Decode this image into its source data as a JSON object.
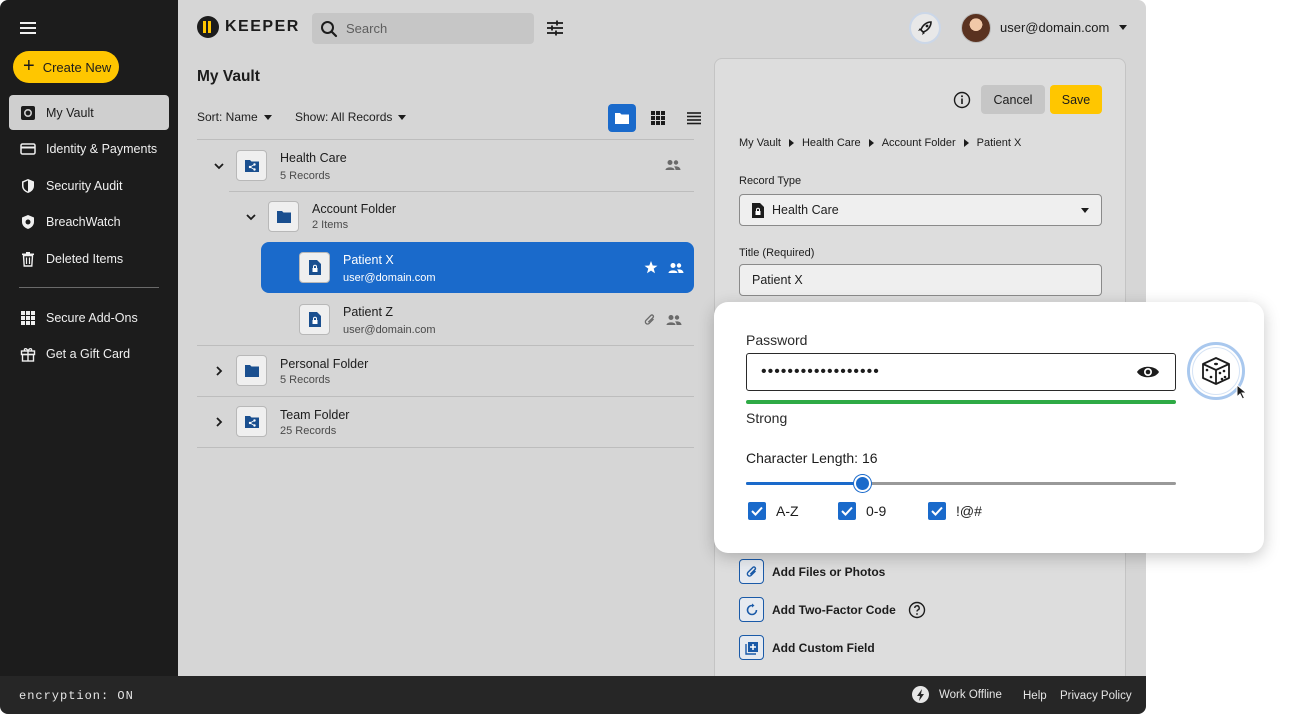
{
  "brand": {
    "name": "KEEPER"
  },
  "sidebar": {
    "create_label": "Create New",
    "items": [
      {
        "label": "My Vault",
        "icon": "vault-icon",
        "active": true
      },
      {
        "label": "Identity & Payments",
        "icon": "card-icon"
      },
      {
        "label": "Security Audit",
        "icon": "shield-icon"
      },
      {
        "label": "BreachWatch",
        "icon": "breachwatch-icon"
      },
      {
        "label": "Deleted Items",
        "icon": "trash-icon"
      }
    ],
    "extras": [
      {
        "label": "Secure Add-Ons",
        "icon": "grid-icon"
      },
      {
        "label": "Get a Gift Card",
        "icon": "gift-icon"
      }
    ]
  },
  "header": {
    "search_placeholder": "Search",
    "user_email": "user@domain.com"
  },
  "vault": {
    "title": "My Vault",
    "sort_label": "Sort: Name",
    "show_label": "Show: All Records",
    "rows": [
      {
        "name": "Health Care",
        "sub": "5 Records"
      },
      {
        "name": "Account Folder",
        "sub": "2 Items"
      },
      {
        "name": "Patient X",
        "sub": "user@domain.com"
      },
      {
        "name": "Patient Z",
        "sub": "user@domain.com"
      },
      {
        "name": "Personal Folder",
        "sub": "5 Records"
      },
      {
        "name": "Team Folder",
        "sub": "25 Records"
      }
    ]
  },
  "record": {
    "cancel_label": "Cancel",
    "save_label": "Save",
    "breadcrumb": [
      "My Vault",
      "Health Care",
      "Account Folder",
      "Patient X"
    ],
    "record_type_label": "Record Type",
    "record_type_value": "Health Care",
    "title_label": "Title (Required)",
    "title_value": "Patient X",
    "addons": [
      "Add Files or Photos",
      "Add Two-Factor Code",
      "Add Custom Field"
    ]
  },
  "password": {
    "label": "Password",
    "value": "••••••••••••••••••",
    "strength": "Strong",
    "length_label": "Character Length: 16",
    "length_fraction": 0.27,
    "options": [
      "A-Z",
      "0-9",
      "!@#"
    ]
  },
  "footer": {
    "encryption": "encryption: ON",
    "offline": "Work Offline",
    "help": "Help",
    "privacy": "Privacy Policy"
  },
  "colors": {
    "accent": "#1a6acb",
    "brand": "#ffc600",
    "strength": "#2eaa45"
  }
}
